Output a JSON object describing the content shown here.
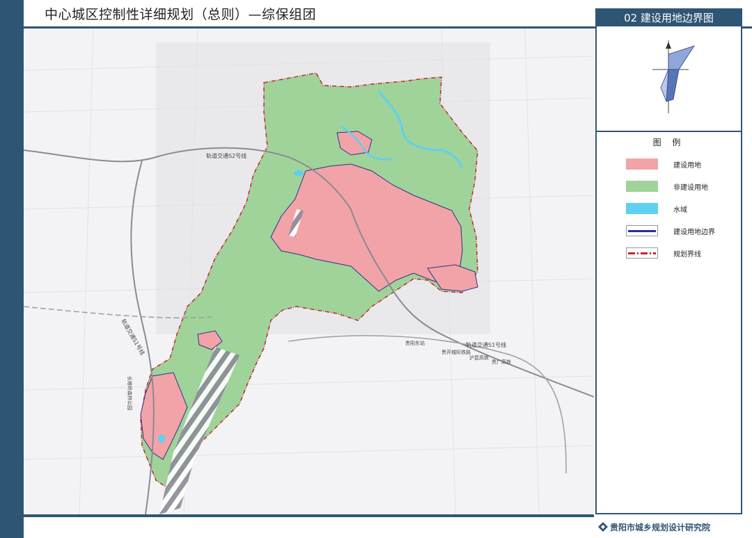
{
  "header": {
    "title": "中心城区控制性详细规划（总则）—综保组团"
  },
  "panel": {
    "title": "02 建设用地边界图"
  },
  "legend": {
    "title": "图 例",
    "items": [
      {
        "label": "建设用地",
        "color": "#f2a3a8",
        "kind": "fill"
      },
      {
        "label": "非建设用地",
        "color": "#9fd39a",
        "kind": "fill"
      },
      {
        "label": "水域",
        "color": "#5fd0f0",
        "kind": "fill"
      },
      {
        "label": "建设用地边界",
        "color": "#2b2f8f",
        "kind": "line"
      },
      {
        "label": "规划界线",
        "color": "#c0282d",
        "kind": "dashline"
      }
    ]
  },
  "map": {
    "labels": [
      {
        "text": "轨道交通S2号线"
      },
      {
        "text": "轨道交通S1号线"
      },
      {
        "text": "轨道交通S1号线"
      },
      {
        "text": "贵阳东站"
      },
      {
        "text": "贵开城际铁路"
      },
      {
        "text": "沪昆高铁"
      },
      {
        "text": "贵广高铁"
      },
      {
        "text": "长坡岭森林公园"
      }
    ]
  },
  "footer": {
    "org": "贵阳市城乡规划设计研究院"
  }
}
